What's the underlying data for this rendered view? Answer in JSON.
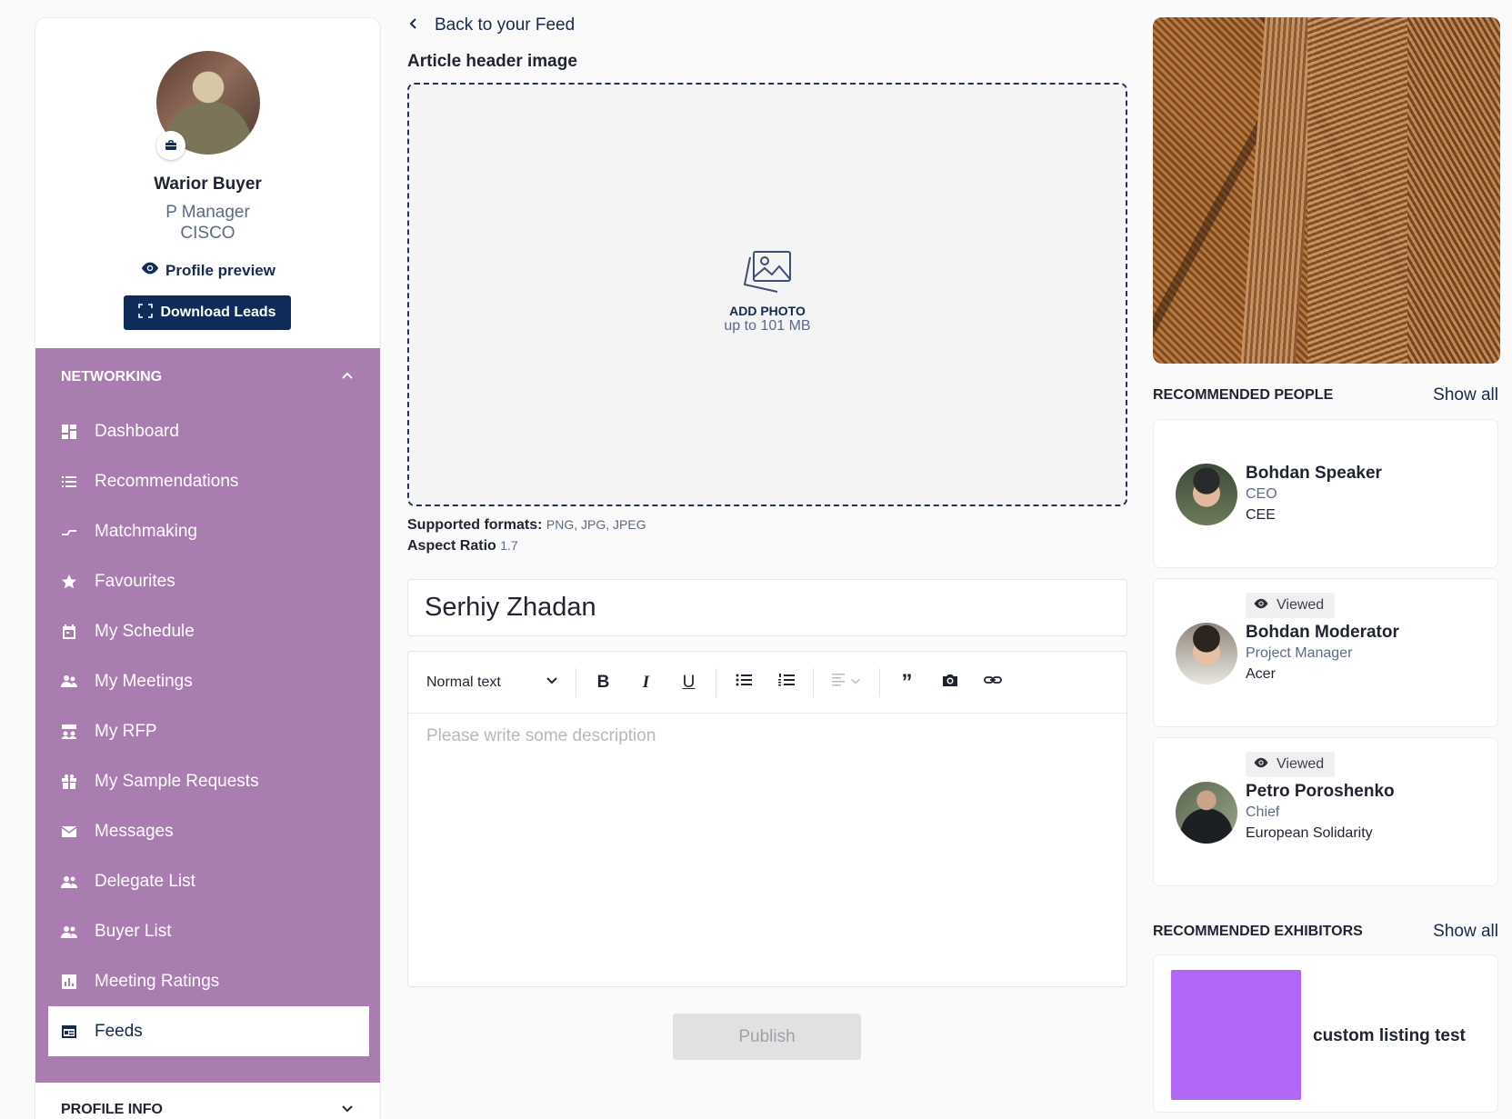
{
  "profile": {
    "name": "Warior Buyer",
    "role": "P Manager",
    "company": "CISCO",
    "preview_label": "Profile preview",
    "download_label": "Download Leads"
  },
  "nav": {
    "section_title": "NETWORKING",
    "items": [
      {
        "label": "Dashboard",
        "icon": "dashboard-icon"
      },
      {
        "label": "Recommendations",
        "icon": "list-icon"
      },
      {
        "label": "Matchmaking",
        "icon": "matchmaking-icon"
      },
      {
        "label": "Favourites",
        "icon": "star-icon"
      },
      {
        "label": "My Schedule",
        "icon": "calendar-icon"
      },
      {
        "label": "My Meetings",
        "icon": "meetings-icon"
      },
      {
        "label": "My RFP",
        "icon": "rfp-icon"
      },
      {
        "label": "My Sample Requests",
        "icon": "gift-icon"
      },
      {
        "label": "Messages",
        "icon": "mail-icon"
      },
      {
        "label": "Delegate List",
        "icon": "people-icon"
      },
      {
        "label": "Buyer List",
        "icon": "people-icon"
      },
      {
        "label": "Meeting Ratings",
        "icon": "chart-icon"
      },
      {
        "label": "Feeds",
        "icon": "feeds-icon",
        "active": true
      }
    ],
    "profile_info": "PROFILE INFO"
  },
  "main": {
    "back_label": "Back to your Feed",
    "header_image_label": "Article header image",
    "add_photo": "ADD PHOTO",
    "size_limit": "up to 101 MB",
    "formats_label": "Supported formats:",
    "formats_value": "PNG, JPG, JPEG",
    "aspect_label": "Aspect Ratio",
    "aspect_value": "1.7",
    "title_value": "Serhiy Zhadan",
    "text_style": "Normal text",
    "description_placeholder": "Please write some description",
    "publish_label": "Publish"
  },
  "right": {
    "people_title": "RECOMMENDED PEOPLE",
    "show_all": "Show all",
    "people": [
      {
        "name": "Bohdan Speaker",
        "role": "CEO",
        "company": "CEE",
        "viewed": false
      },
      {
        "name": "Bohdan Moderator",
        "role": "Project Manager",
        "company": "Acer",
        "viewed": true,
        "viewed_label": "Viewed"
      },
      {
        "name": "Petro Poroshenko",
        "role": "Chief",
        "company": "European Solidarity",
        "viewed": true,
        "viewed_label": "Viewed"
      }
    ],
    "exhibitors_title": "RECOMMENDED EXHIBITORS",
    "exhibitors": [
      {
        "name": "custom listing test",
        "logo_color": "#b067f6"
      }
    ]
  },
  "colors": {
    "nav_bg": "#a97daf",
    "primary": "#0e2c57",
    "accent_text": "#16294f"
  }
}
